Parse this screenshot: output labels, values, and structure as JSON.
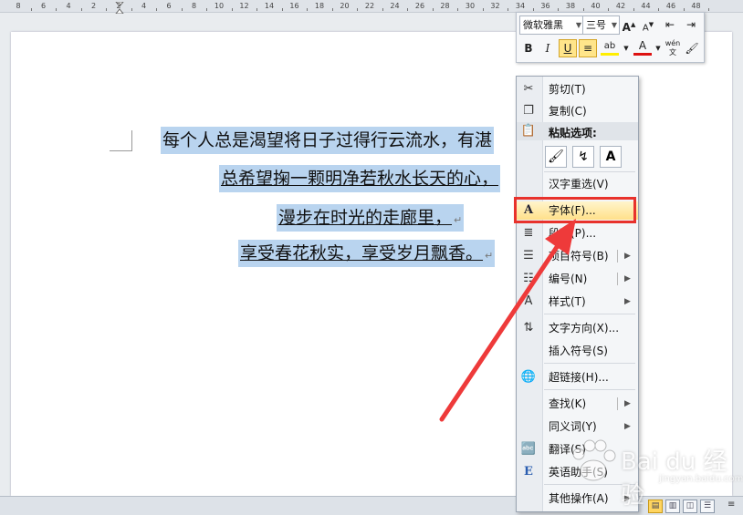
{
  "ruler": {
    "ticks": [
      "8",
      "6",
      "4",
      "2",
      "2",
      "4",
      "6",
      "8",
      "10",
      "12",
      "14",
      "16",
      "18",
      "20",
      "22",
      "24",
      "26",
      "28",
      "30",
      "32",
      "34",
      "36",
      "38",
      "40",
      "42",
      "44",
      "46",
      "48"
    ]
  },
  "document": {
    "lines": [
      "每个人总是渴望将日子过得行云流水，有湛",
      "总希望掬一颗明净若秋水长天的心，",
      "漫步在时光的走廊里，",
      "享受春花秋实，享受岁月飘香。"
    ],
    "line2_spell": "掬",
    "return_mark": "↵"
  },
  "mini_toolbar": {
    "font_name": "微软雅黑",
    "font_size": "三号",
    "grow_font": "A",
    "shrink_font": "A",
    "bold": "B",
    "italic": "I",
    "underline": "U",
    "highlight": "ab",
    "font_color": "A",
    "phonetic": "wén"
  },
  "context_menu": {
    "cut": "剪切(T)",
    "copy": "复制(C)",
    "paste_options": "粘贴选项:",
    "reconvert": "汉字重选(V)",
    "font": "字体(F)...",
    "paragraph": "段落(P)...",
    "bullets": "项目符号(B)",
    "numbering": "编号(N)",
    "styles": "样式(T)",
    "text_direction": "文字方向(X)...",
    "insert_symbol": "插入符号(S)",
    "hyperlink": "超链接(H)...",
    "lookup": "查找(K)",
    "synonyms": "同义词(Y)",
    "translate": "翻译(S)",
    "english_assistant": "英语助手(S)",
    "other_actions": "其他操作(A)"
  },
  "watermark": {
    "text": "Bai du 经验",
    "sub": "jingyan.baidu.com"
  },
  "colors": {
    "selection": "#b9d4ef",
    "highlight_border": "#e8322c",
    "arrow": "#ee3a3a"
  }
}
